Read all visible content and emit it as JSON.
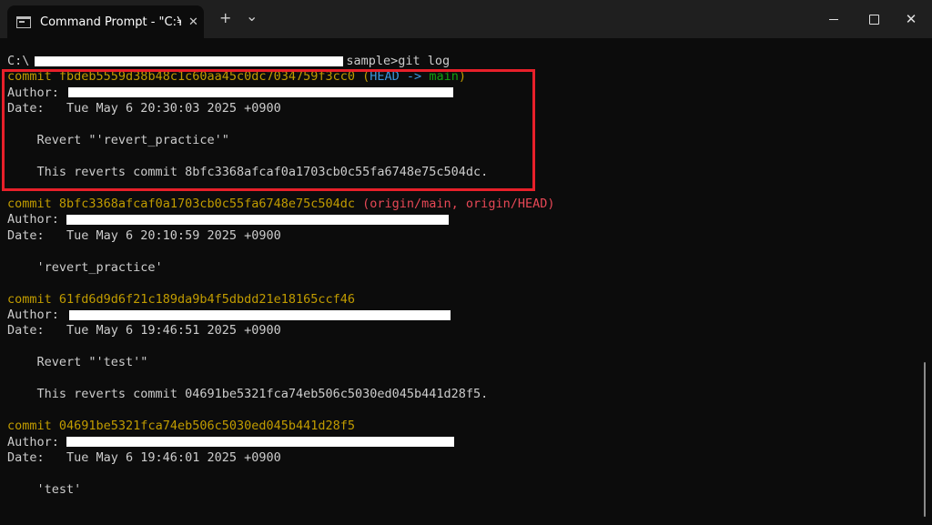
{
  "window": {
    "tab_title": "Command Prompt - \"C:¥Progr",
    "tab_close": "✕",
    "new_tab": "+",
    "dropdown": "⌄",
    "minimize_icon": "minimize-icon",
    "maximize_icon": "maximize-icon",
    "close_glyph": "✕"
  },
  "terminal": {
    "prompt_prefix": "C:\\",
    "prompt_suffix": "sample>git log",
    "commits": [
      {
        "commit_label": "commit ",
        "hash": "fbdeb5559d38b48c1c60aa45c0dc7034759f3cc0",
        "refs_open": " (",
        "ref_head": "HEAD",
        "ref_arrow": " -> ",
        "ref_branch": "main",
        "refs_close": ")",
        "author_label": "Author: ",
        "date_line": "Date:   Tue May 6 20:30:03 2025 +0900",
        "message": [
          "Revert \"'revert_practice'\"",
          "This reverts commit 8bfc3368afcaf0a1703cb0c55fa6748e75c504dc."
        ]
      },
      {
        "commit_label": "commit ",
        "hash": "8bfc3368afcaf0a1703cb0c55fa6748e75c504dc",
        "refs": " (origin/main, origin/HEAD)",
        "author_label": "Author: ",
        "date_line": "Date:   Tue May 6 20:10:59 2025 +0900",
        "message": [
          "'revert_practice'"
        ]
      },
      {
        "commit_label": "commit ",
        "hash": "61fd6d9d6f21c189da9b4f5dbdd21e18165ccf46",
        "author_label": "Author: ",
        "date_line": "Date:   Tue May 6 19:46:51 2025 +0900",
        "message": [
          "Revert \"'test'\"",
          "This reverts commit 04691be5321fca74eb506c5030ed045b441d28f5."
        ]
      },
      {
        "commit_label": "commit ",
        "hash": "04691be5321fca74eb506c5030ed045b441d28f5",
        "author_label": "Author: ",
        "date_line": "Date:   Tue May 6 19:46:01 2025 +0900",
        "message": [
          "'test'"
        ]
      }
    ]
  },
  "colors": {
    "background": "#0c0c0c",
    "commit_yellow": "#c19c00",
    "head_cyan": "#3a96dd",
    "branch_green": "#13a10e",
    "origin_red": "#e74856",
    "highlight_red": "#e8202a"
  }
}
